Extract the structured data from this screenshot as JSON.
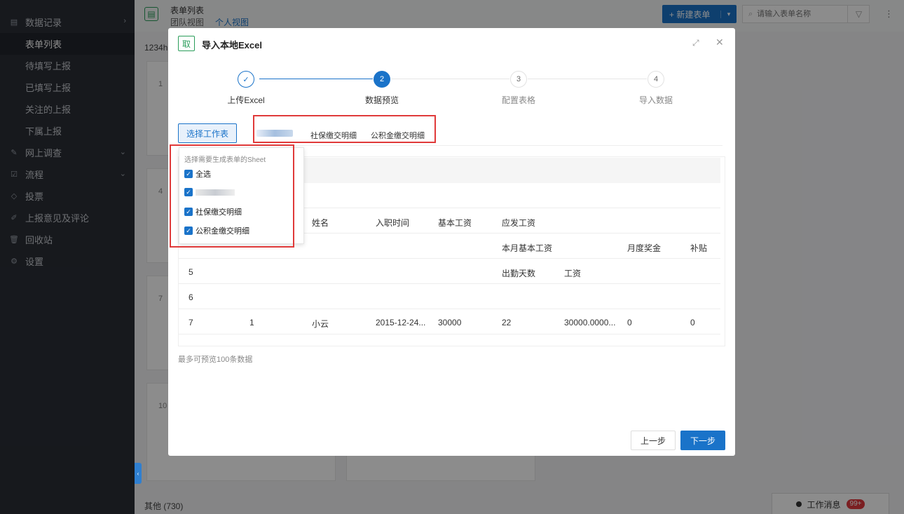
{
  "sidebar": {
    "items": [
      {
        "label": "数据记录"
      },
      {
        "label": "表单列表"
      },
      {
        "label": "待填写上报"
      },
      {
        "label": "已填写上报"
      },
      {
        "label": "关注的上报"
      },
      {
        "label": "下属上报"
      },
      {
        "label": "网上调查"
      },
      {
        "label": "流程"
      },
      {
        "label": "投票"
      },
      {
        "label": "上报意见及评论"
      },
      {
        "label": "回收站"
      },
      {
        "label": "设置"
      }
    ]
  },
  "header": {
    "title": "表单列表",
    "tabs": [
      "团队视图",
      "个人视图"
    ],
    "new_button": "+ 新建表单",
    "search_placeholder": "请输入表单名称"
  },
  "main": {
    "count_label": "1234hh",
    "card_numbers": [
      "1",
      "4",
      "7",
      "10"
    ],
    "other_label": "其他 (730)"
  },
  "work_message": {
    "label": "工作消息",
    "badge": "99+"
  },
  "modal": {
    "title": "导入本地Excel",
    "steps": [
      {
        "index": "✓",
        "label": "上传Excel",
        "state": "done"
      },
      {
        "index": "2",
        "label": "数据预览",
        "state": "active"
      },
      {
        "index": "3",
        "label": "配置表格",
        "state": "todo"
      },
      {
        "index": "4",
        "label": "导入数据",
        "state": "todo"
      }
    ],
    "select_sheet_button": "选择工作表",
    "sheet_tabs": [
      "社保缴交明细",
      "公积金缴交明细"
    ],
    "dropdown": {
      "title": "选择需要生成表单的Sheet",
      "items": [
        "全选",
        "社保缴交明细",
        "公积金缴交明细"
      ]
    },
    "table": {
      "rows": [
        {
          "cells": [
            "",
            "",
            "姓名",
            "入职时间",
            "基本工资",
            "应发工资",
            "",
            "",
            ""
          ]
        },
        {
          "cells": [
            "",
            "",
            "",
            "",
            "",
            "本月基本工资",
            "",
            "月度奖金",
            "补贴"
          ]
        },
        {
          "cells": [
            "5",
            "",
            "",
            "",
            "",
            "出勤天数",
            "工资",
            "",
            ""
          ]
        },
        {
          "cells": [
            "6",
            "",
            "",
            "",
            "",
            "",
            "",
            "",
            ""
          ]
        },
        {
          "cells": [
            "7",
            "1",
            "小云",
            "2015-12-24...",
            "30000",
            "22",
            "30000.0000...",
            "0",
            "0"
          ]
        }
      ]
    },
    "preview_note": "最多可预览100条数据",
    "prev_button": "上一步",
    "next_button": "下一步"
  },
  "colors": {
    "accent": "#1a73c9",
    "highlight": "#e03a3a",
    "sidebar_bg": "#2a2e36"
  }
}
